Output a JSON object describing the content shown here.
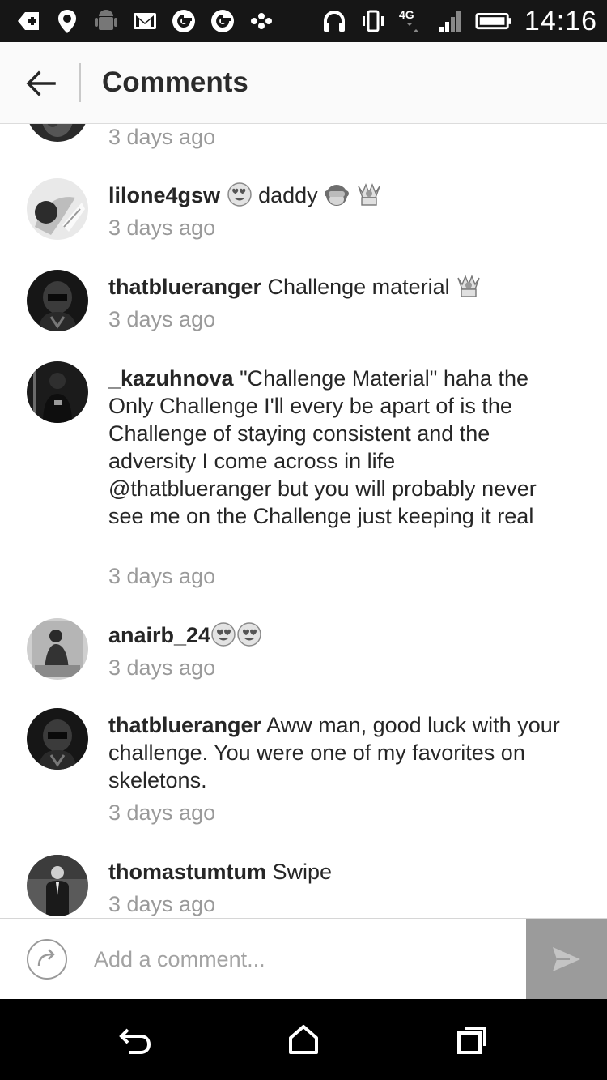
{
  "status_bar": {
    "time": "14:16",
    "network_label": "4G",
    "icons": [
      "add-icon",
      "location-icon",
      "android-icon",
      "gmail-icon",
      "google-icon",
      "google-icon",
      "dots-icon",
      "headphones-icon",
      "vibrate-icon",
      "network-4g-icon",
      "signal-icon",
      "battery-icon"
    ]
  },
  "header": {
    "title": "Comments",
    "back_icon": "arrow-left-icon"
  },
  "comments": [
    {
      "username": "",
      "text": "",
      "time": "3 days ago",
      "emojis": []
    },
    {
      "username": "lilone4gsw",
      "text": "daddy",
      "time": "3 days ago",
      "emojis_before": [
        "heart-eyes"
      ],
      "emojis_after": [
        "see-no-evil-monkey",
        "raised-hands"
      ]
    },
    {
      "username": "thatblueranger",
      "text": "Challenge material",
      "time": "3 days ago",
      "emojis_after": [
        "raised-hands"
      ]
    },
    {
      "username": "_kazuhnova",
      "text": "\"Challenge Material\" haha the Only Challenge I'll every be apart of is the Challenge of staying consistent and the adversity I come across in life @thatblueranger but you will probably never see me on the Challenge just keeping it real",
      "time": "3 days ago"
    },
    {
      "username": "anairb_24",
      "text": "",
      "time": "3 days ago",
      "emojis_after": [
        "heart-eyes",
        "heart-eyes"
      ]
    },
    {
      "username": "thatblueranger",
      "text": "Aww man, good luck with your challenge. You were one of my favorites on skeletons.",
      "time": "3 days ago"
    },
    {
      "username": "thomastumtum",
      "text": "Swipe",
      "time": "3 days ago"
    }
  ],
  "composer": {
    "placeholder": "Add a comment...",
    "left_icon": "refresh-icon",
    "send_icon": "send-icon"
  },
  "nav": {
    "back_icon": "nav-back-icon",
    "home_icon": "nav-home-icon",
    "recents_icon": "nav-recents-icon"
  }
}
